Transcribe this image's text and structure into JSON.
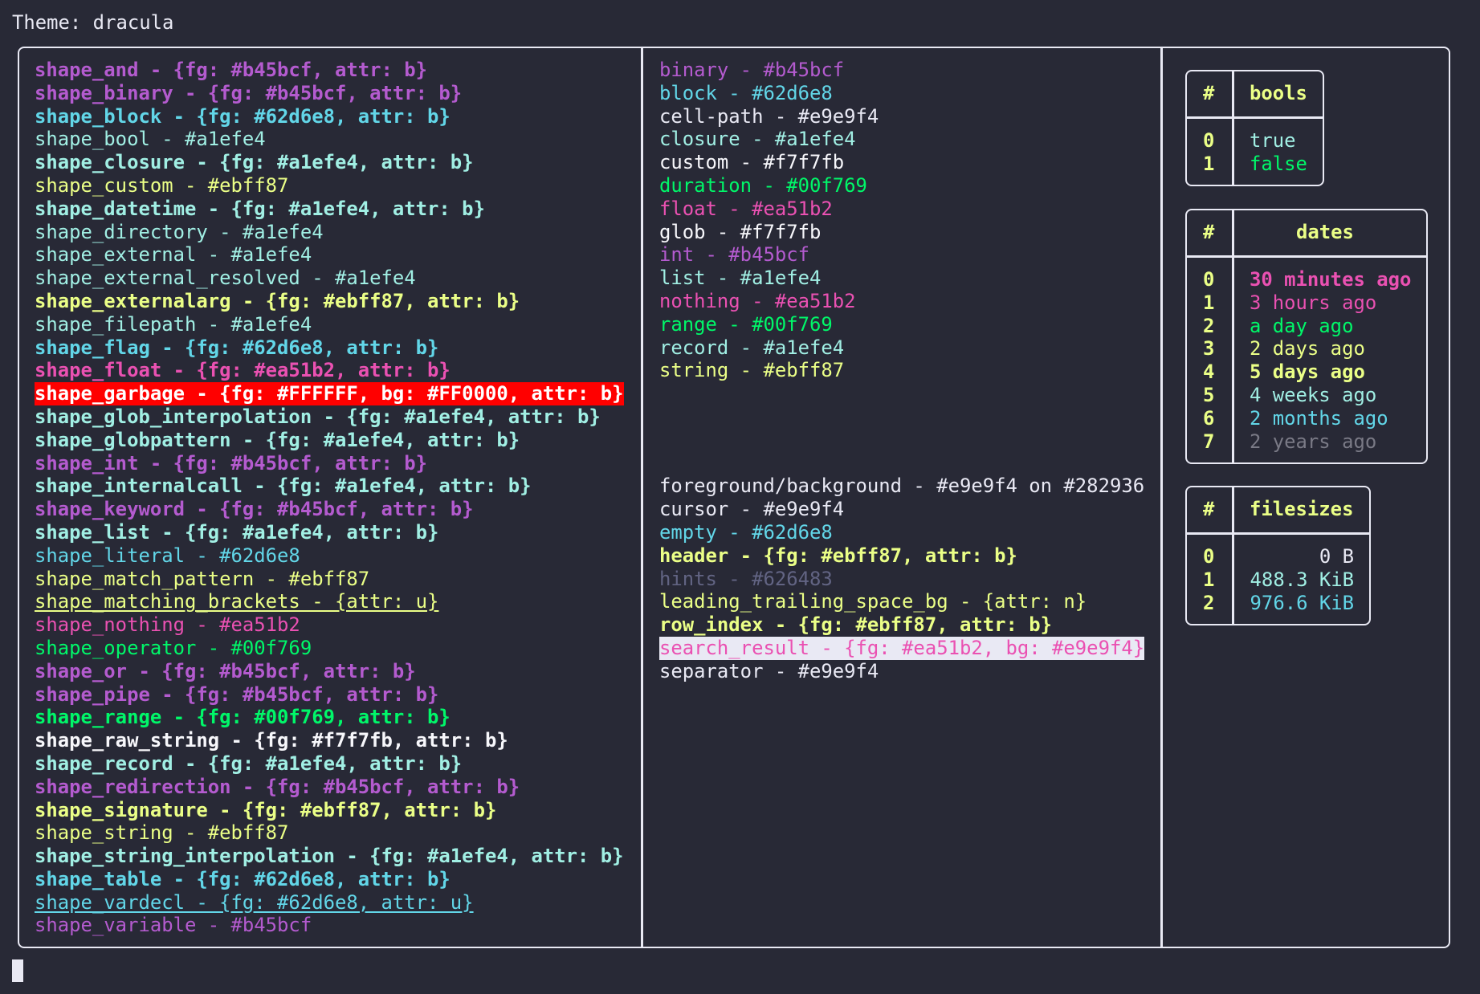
{
  "theme_line": "Theme: dracula",
  "colors": {
    "background": "#282936",
    "foreground": "#e9e9f4",
    "purple": "#b45bcf",
    "blue": "#62d6e8",
    "cyan": "#a1efe4",
    "yellow": "#ebff87",
    "pink": "#ea51b2",
    "green": "#00f769",
    "white": "#f7f7fb",
    "hints": "#626483",
    "garbage_bg": "#FF0000",
    "garbage_fg": "#FFFFFF"
  },
  "shapes": [
    {
      "text": "shape_and - {fg: #b45bcf, attr: b}",
      "fg": "#b45bcf",
      "bold": true
    },
    {
      "text": "shape_binary - {fg: #b45bcf, attr: b}",
      "fg": "#b45bcf",
      "bold": true
    },
    {
      "text": "shape_block - {fg: #62d6e8, attr: b}",
      "fg": "#62d6e8",
      "bold": true
    },
    {
      "text": "shape_bool - #a1efe4",
      "fg": "#a1efe4"
    },
    {
      "text": "shape_closure - {fg: #a1efe4, attr: b}",
      "fg": "#a1efe4",
      "bold": true
    },
    {
      "text": "shape_custom - #ebff87",
      "fg": "#ebff87"
    },
    {
      "text": "shape_datetime - {fg: #a1efe4, attr: b}",
      "fg": "#a1efe4",
      "bold": true
    },
    {
      "text": "shape_directory - #a1efe4",
      "fg": "#a1efe4"
    },
    {
      "text": "shape_external - #a1efe4",
      "fg": "#a1efe4"
    },
    {
      "text": "shape_external_resolved - #a1efe4",
      "fg": "#a1efe4"
    },
    {
      "text": "shape_externalarg - {fg: #ebff87, attr: b}",
      "fg": "#ebff87",
      "bold": true
    },
    {
      "text": "shape_filepath - #a1efe4",
      "fg": "#a1efe4"
    },
    {
      "text": "shape_flag - {fg: #62d6e8, attr: b}",
      "fg": "#62d6e8",
      "bold": true
    },
    {
      "text": "shape_float - {fg: #ea51b2, attr: b}",
      "fg": "#ea51b2",
      "bold": true
    },
    {
      "text": "shape_garbage - {fg: #FFFFFF, bg: #FF0000, attr: b}",
      "fg": "#FFFFFF",
      "bg": "#FF0000",
      "bold": true
    },
    {
      "text": "shape_glob_interpolation - {fg: #a1efe4, attr: b}",
      "fg": "#a1efe4",
      "bold": true
    },
    {
      "text": "shape_globpattern - {fg: #a1efe4, attr: b}",
      "fg": "#a1efe4",
      "bold": true
    },
    {
      "text": "shape_int - {fg: #b45bcf, attr: b}",
      "fg": "#b45bcf",
      "bold": true
    },
    {
      "text": "shape_internalcall - {fg: #a1efe4, attr: b}",
      "fg": "#a1efe4",
      "bold": true
    },
    {
      "text": "shape_keyword - {fg: #b45bcf, attr: b}",
      "fg": "#b45bcf",
      "bold": true
    },
    {
      "text": "shape_list - {fg: #a1efe4, attr: b}",
      "fg": "#a1efe4",
      "bold": true
    },
    {
      "text": "shape_literal - #62d6e8",
      "fg": "#62d6e8"
    },
    {
      "text": "shape_match_pattern - #ebff87",
      "fg": "#ebff87"
    },
    {
      "text": "shape_matching_brackets - {attr: u}",
      "fg": "#ebff87",
      "underline": true
    },
    {
      "text": "shape_nothing - #ea51b2",
      "fg": "#ea51b2"
    },
    {
      "text": "shape_operator - #00f769",
      "fg": "#00f769"
    },
    {
      "text": "shape_or - {fg: #b45bcf, attr: b}",
      "fg": "#b45bcf",
      "bold": true
    },
    {
      "text": "shape_pipe - {fg: #b45bcf, attr: b}",
      "fg": "#b45bcf",
      "bold": true
    },
    {
      "text": "shape_range - {fg: #00f769, attr: b}",
      "fg": "#00f769",
      "bold": true
    },
    {
      "text": "shape_raw_string - {fg: #f7f7fb, attr: b}",
      "fg": "#f7f7fb",
      "bold": true
    },
    {
      "text": "shape_record - {fg: #a1efe4, attr: b}",
      "fg": "#a1efe4",
      "bold": true
    },
    {
      "text": "shape_redirection - {fg: #b45bcf, attr: b}",
      "fg": "#b45bcf",
      "bold": true
    },
    {
      "text": "shape_signature - {fg: #ebff87, attr: b}",
      "fg": "#ebff87",
      "bold": true
    },
    {
      "text": "shape_string - #ebff87",
      "fg": "#ebff87"
    },
    {
      "text": "shape_string_interpolation - {fg: #a1efe4, attr: b}",
      "fg": "#a1efe4",
      "bold": true
    },
    {
      "text": "shape_table - {fg: #62d6e8, attr: b}",
      "fg": "#62d6e8",
      "bold": true
    },
    {
      "text": "shape_vardecl - {fg: #62d6e8, attr: u}",
      "fg": "#62d6e8",
      "underline": true
    },
    {
      "text": "shape_variable - #b45bcf",
      "fg": "#b45bcf"
    }
  ],
  "types": [
    {
      "text": "binary - #b45bcf",
      "fg": "#b45bcf"
    },
    {
      "text": "block - #62d6e8",
      "fg": "#62d6e8"
    },
    {
      "text": "cell-path - #e9e9f4",
      "fg": "#e9e9f4"
    },
    {
      "text": "closure - #a1efe4",
      "fg": "#a1efe4"
    },
    {
      "text": "custom - #f7f7fb",
      "fg": "#f7f7fb"
    },
    {
      "text": "duration - #00f769",
      "fg": "#00f769"
    },
    {
      "text": "float - #ea51b2",
      "fg": "#ea51b2"
    },
    {
      "text": "glob - #f7f7fb",
      "fg": "#f7f7fb"
    },
    {
      "text": "int - #b45bcf",
      "fg": "#b45bcf"
    },
    {
      "text": "list - #a1efe4",
      "fg": "#a1efe4"
    },
    {
      "text": "nothing - #ea51b2",
      "fg": "#ea51b2"
    },
    {
      "text": "range - #00f769",
      "fg": "#00f769"
    },
    {
      "text": "record - #a1efe4",
      "fg": "#a1efe4"
    },
    {
      "text": "string - #ebff87",
      "fg": "#ebff87"
    }
  ],
  "ui_colors": [
    {
      "text": "foreground/background - #e9e9f4 on #282936",
      "fg": "#e9e9f4"
    },
    {
      "text": "cursor - #e9e9f4",
      "fg": "#e9e9f4"
    },
    {
      "text": "empty - #62d6e8",
      "fg": "#62d6e8"
    },
    {
      "text": "header - {fg: #ebff87, attr: b}",
      "fg": "#ebff87",
      "bold": true
    },
    {
      "text": "hints - #626483",
      "fg": "#626483"
    },
    {
      "text": "leading_trailing_space_bg - {attr: n}",
      "fg": "#ebff87"
    },
    {
      "text": "row_index - {fg: #ebff87, attr: b}",
      "fg": "#ebff87",
      "bold": true
    },
    {
      "text": "search_result - {fg: #ea51b2, bg: #e9e9f4}",
      "fg": "#ea51b2",
      "bg": "#e9e9f4"
    },
    {
      "text": "separator - #e9e9f4",
      "fg": "#e9e9f4"
    }
  ],
  "tables": {
    "bools": {
      "index_header": "#",
      "header": "bools",
      "rows": [
        {
          "index": "0",
          "value": "true",
          "fg": "#a1efe4"
        },
        {
          "index": "1",
          "value": "false",
          "fg": "#00f769"
        }
      ]
    },
    "dates": {
      "index_header": "#",
      "header": "dates",
      "rows": [
        {
          "index": "0",
          "value": "30 minutes ago",
          "fg": "#ea51b2",
          "bold": true
        },
        {
          "index": "1",
          "value": "3 hours ago",
          "fg": "#ea51b2"
        },
        {
          "index": "2",
          "value": "a day ago",
          "fg": "#00f769"
        },
        {
          "index": "3",
          "value": "2 days ago",
          "fg": "#ebff87"
        },
        {
          "index": "4",
          "value": "5 days ago",
          "fg": "#ebff87",
          "bold": true
        },
        {
          "index": "5",
          "value": "4 weeks ago",
          "fg": "#a1efe4"
        },
        {
          "index": "6",
          "value": "2 months ago",
          "fg": "#62d6e8"
        },
        {
          "index": "7",
          "value": "2 years ago",
          "fg": "#7a7a86"
        }
      ]
    },
    "filesizes": {
      "index_header": "#",
      "header": "filesizes",
      "rows": [
        {
          "index": "0",
          "value": "0 B",
          "fg": "#e9e9f4"
        },
        {
          "index": "1",
          "value": "488.3 KiB",
          "fg": "#a1efe4"
        },
        {
          "index": "2",
          "value": "976.6 KiB",
          "fg": "#62d6e8"
        }
      ]
    }
  }
}
